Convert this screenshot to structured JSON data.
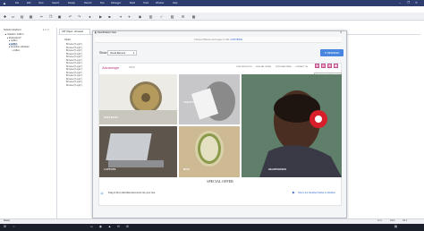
{
  "window": {
    "menu": [
      "File",
      "Edit",
      "View",
      "Search",
      "Design",
      "Record",
      "Run",
      "Debugger",
      "Build",
      "Tools",
      "Window",
      "Help"
    ],
    "controls": [
      "–",
      "❐",
      "✕"
    ]
  },
  "left_panel": {
    "title": "Solution Explorer",
    "controls": "▾ ✕ ✕",
    "tree": [
      "Solution 'ordbm'",
      "Extensions*",
      "ordbm",
      "ordbm",
      "Function Libraries",
      "ordbm"
    ]
  },
  "tab": {
    "label": "UFT Object - All tested"
  },
  "code": {
    "heading": "Option",
    "lines": [
      "Browser(\"Login\").",
      "Browser(\"Login\").",
      "Browser(\"Login\").",
      "Browser(\"Login\").",
      "Browser(\"Login\").",
      "Browser(\"Login\").",
      "Browser(\"Login\").",
      "Browser(\"Login\").",
      "Browser(\"Login\").",
      "Browser(\"Login\").",
      "Browser(\"Login\").",
      "Browser(\"Login\").",
      "Browser(\"Login\").",
      "Browser(\"Login\")."
    ]
  },
  "modal": {
    "title": "Identification View",
    "info_text": "Choose different web page or URL",
    "info_link": "CONTINUE",
    "show_label": "Show",
    "show_value": "Visual Element",
    "refresh_label": "REFRESH"
  },
  "website": {
    "brand": "Advantage",
    "brand_sub": "DEMO",
    "nav": [
      "OUR PRODUCTS",
      "SPECIAL OFFER",
      "POPULAR ITEMS",
      "CONTACT US"
    ],
    "tooltip": "Visual element: Link",
    "tiles": [
      {
        "label": "SPEAKERS"
      },
      {
        "label": "TABLETS"
      },
      {
        "label": "HEADPHONES"
      },
      {
        "label": "LAPTOPS"
      },
      {
        "label": "MICE"
      }
    ],
    "special_offer": "SPECIAL OFFER"
  },
  "modal_footer": {
    "drag_tip": "Drag & Drop identified elements into your test",
    "how_link": "How is the Identified Visible on Website"
  },
  "status": {
    "left": "Ready",
    "ln": "Ln 1",
    "col": "Col 1",
    "ch": "Ch 1"
  },
  "colors": {
    "title_bar": "#2d3e6e",
    "accent": "#4a86e0",
    "brand": "#b23c7c",
    "taskbar": "#1a1f2b"
  }
}
